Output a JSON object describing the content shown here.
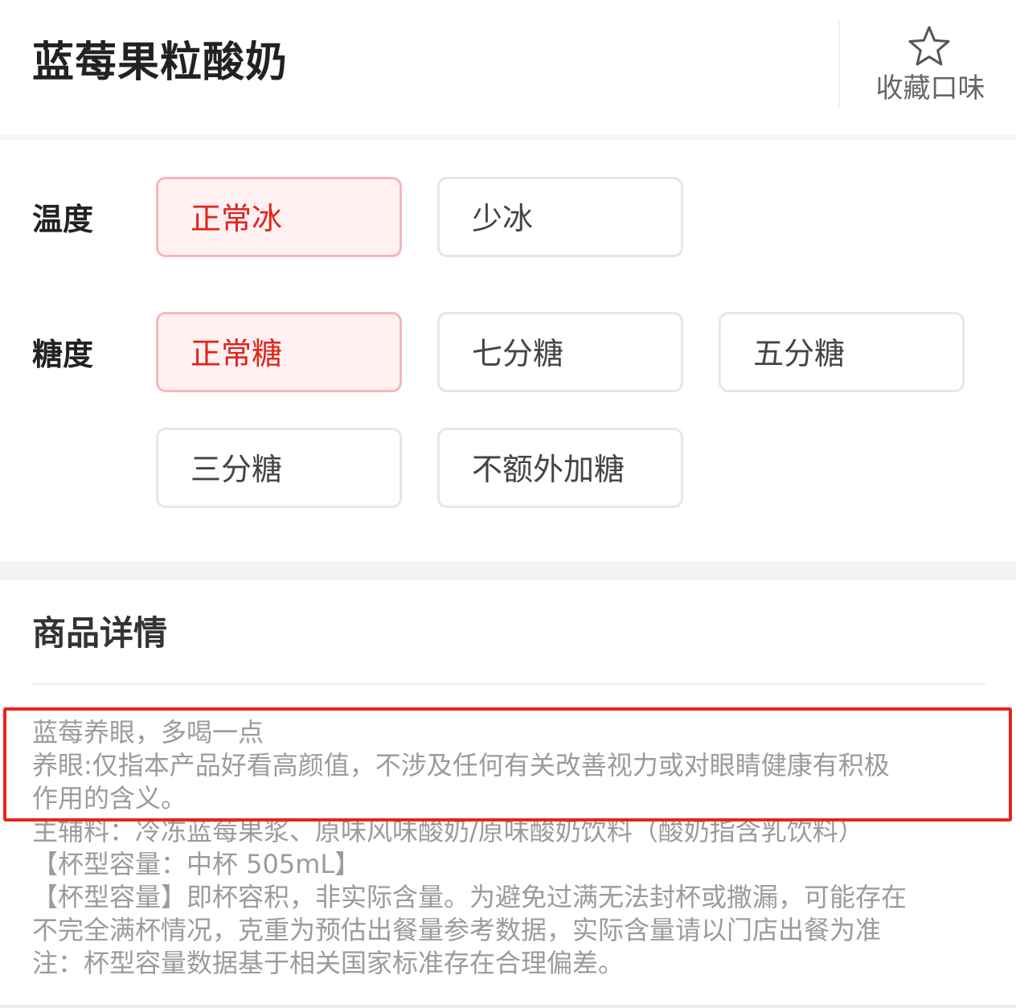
{
  "header": {
    "title": "蓝莓果粒酸奶",
    "favorite_label": "收藏口味",
    "favorite_icon": "star-outline-icon"
  },
  "options": {
    "temperature": {
      "label": "温度",
      "choices": [
        "正常冰",
        "少冰"
      ],
      "selected": "正常冰"
    },
    "sweetness": {
      "label": "糖度",
      "choices": [
        "正常糖",
        "七分糖",
        "五分糖",
        "三分糖",
        "不额外加糖"
      ],
      "selected": "正常糖"
    }
  },
  "details": {
    "title": "商品详情",
    "lines": [
      "蓝莓养眼，多喝一点",
      "养眼:仅指本产品好看高颜值，不涉及任何有关改善视力或对眼睛健康有积极",
      "作用的含义。",
      "主辅料：冷冻蓝莓果浆、原味风味酸奶/原味酸奶饮料（酸奶指含乳饮料）",
      "【杯型容量：中杯 505mL】",
      "【杯型容量】即杯容积，非实际含量。为避免过满无法封杯或撒漏，可能存在",
      "不完全满杯情况，克重为预估出餐量参考数据，实际含量请以门店出餐为准",
      "注：杯型容量数据基于相关国家标准存在合理偏差。"
    ]
  },
  "colors": {
    "accent": "#e2231a",
    "selected_bg": "#fff1f2",
    "selected_border": "#f7b6b9",
    "highlight_border": "#e8231c"
  }
}
